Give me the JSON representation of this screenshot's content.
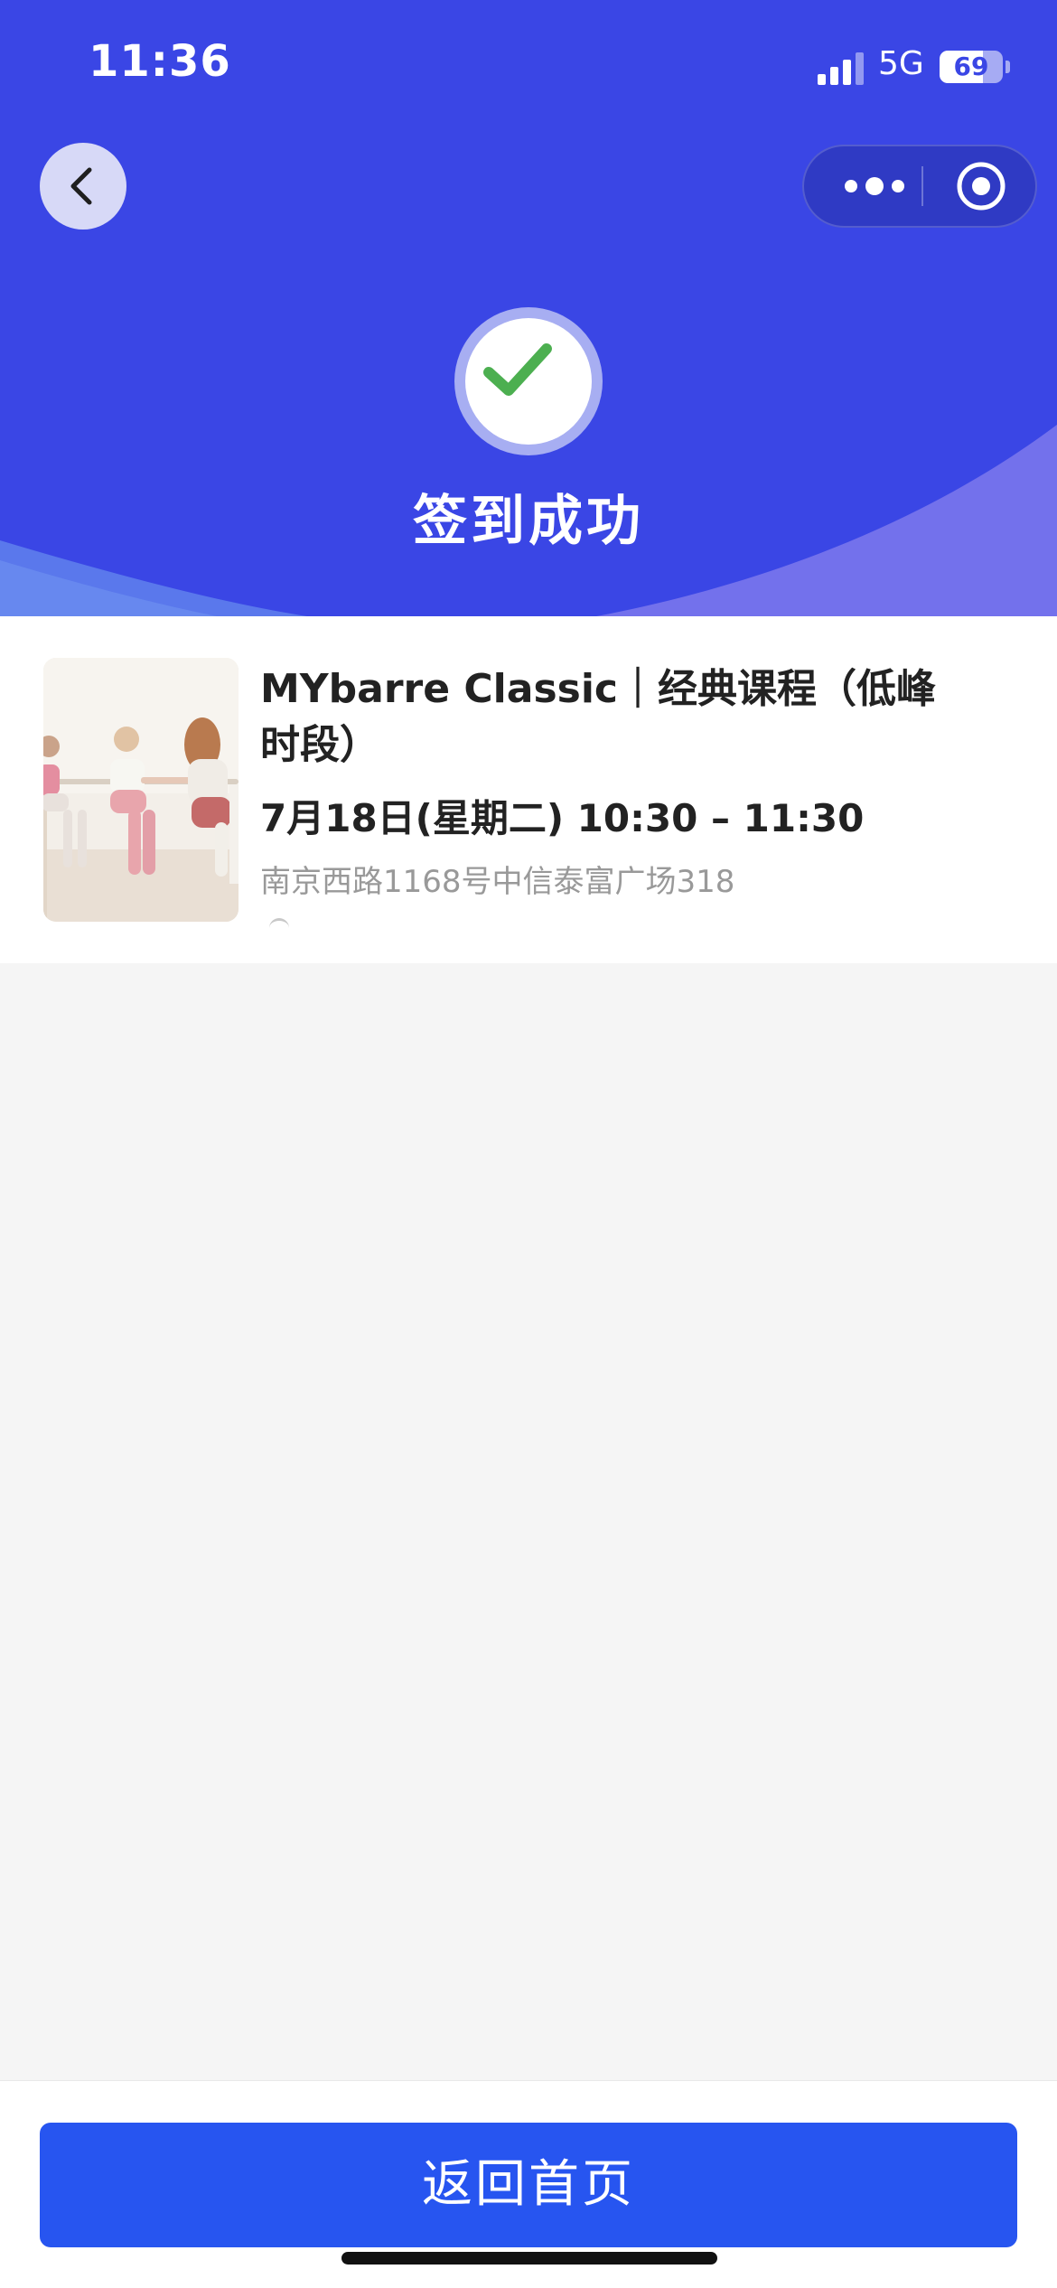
{
  "status_bar": {
    "time": "11:36",
    "network": "5G",
    "battery": "69",
    "battery_level": 0.69,
    "icons": [
      "signal-icon",
      "battery-icon"
    ]
  },
  "nav": {
    "back_icon": "chevron-left-icon",
    "capsule_icons": [
      "more-dots-icon",
      "target-circle-icon"
    ]
  },
  "result": {
    "icon": "check-icon",
    "title": "签到成功"
  },
  "course": {
    "title": "MYbarre Classic｜经典课程（低峰时段）",
    "time": "7月18日(星期二) 10:30 – 11:30",
    "address": "南京西路1168号中信泰富广场318"
  },
  "footer": {
    "home_button_label": "返回首页"
  },
  "colors": {
    "header_blue": "#3a46e5",
    "button_blue": "#2755f0",
    "check_green": "#4caf50",
    "page_background": "#f5f5f5"
  }
}
